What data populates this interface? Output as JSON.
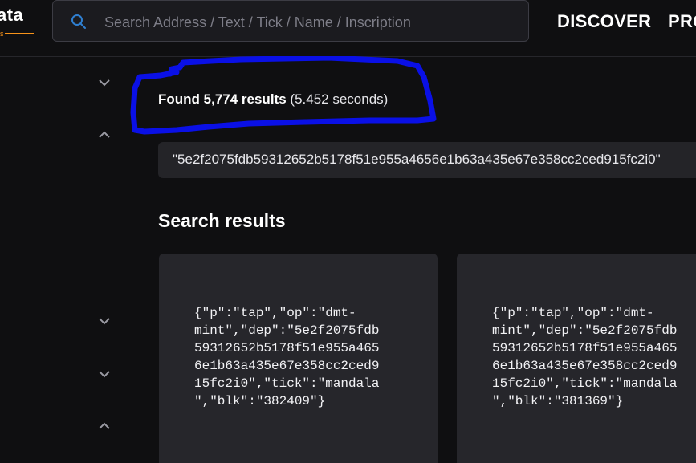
{
  "header": {
    "logo_text": "ata",
    "search_placeholder": "Search Address / Text / Tick / Name / Inscription",
    "nav": [
      "DISCOVER",
      "PRO"
    ]
  },
  "results": {
    "count_label": "Found 5,774 results",
    "duration_label": "(5.452 seconds)",
    "query": "\"5e2f2075fdb59312652b5178f51e955a4656e1b63a435e67e358cc2ced915fc2i0\"",
    "section_title": "Search results"
  },
  "cards": [
    {
      "content": "{\"p\":\"tap\",\"op\":\"dmt-\nmint\",\"dep\":\"5e2f2075fdb\n59312652b5178f51e955a465\n6e1b63a435e67e358cc2ced9\n15fc2i0\",\"tick\":\"mandala\n\",\"blk\":\"382409\"}"
    },
    {
      "content": "{\"p\":\"tap\",\"op\":\"dmt-\nmint\",\"dep\":\"5e2f2075fdb\n59312652b5178f51e955a465\n6e1b63a435e67e358cc2ced9\n15fc2i0\",\"tick\":\"mandala\n\",\"blk\":\"381369\"}"
    }
  ],
  "colors": {
    "background": "#0f0f11",
    "card": "#26262b",
    "annotation": "#0a10e6",
    "accent": "#f7931a",
    "search_icon": "#2f7fd0"
  },
  "icons": [
    "search-icon",
    "chevron-down-icon",
    "chevron-up-icon"
  ]
}
